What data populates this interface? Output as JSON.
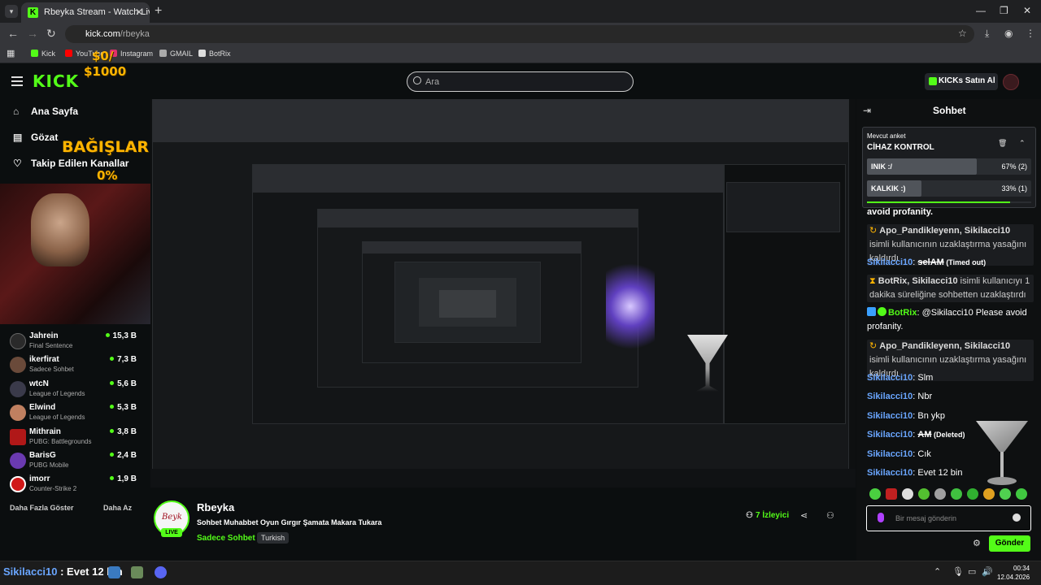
{
  "browser": {
    "tab_title": "Rbeyka Stream - Watch Live on",
    "url_host": "kick.com",
    "url_path": "/rbeyka",
    "bookmarks": [
      "Kick",
      "YouTube",
      "Instagram",
      "GMAIL",
      "BotRix"
    ]
  },
  "header": {
    "logo": "KICK",
    "search_placeholder": "Ara",
    "buy_kicks": "KICKs Satın Al"
  },
  "overlay": {
    "donation_amount": "$0/",
    "donation_goal": "$1000",
    "donations_label": "BAĞIŞLAR",
    "donations_percent": "0%"
  },
  "sidebar": {
    "nav": [
      "Ana Sayfa",
      "Gözat",
      "Takip Edilen Kanallar"
    ],
    "channels": [
      {
        "name": "Jahrein",
        "game": "Final Sentence",
        "viewers": "15,3 B",
        "color": "#2a2a2a"
      },
      {
        "name": "ikerfirat",
        "game": "Sadece Sohbet",
        "viewers": "7,3 B",
        "color": "#6a4a3a"
      },
      {
        "name": "wtcN",
        "game": "League of Legends",
        "viewers": "5,6 B",
        "color": "#3a3a4a"
      },
      {
        "name": "Elwind",
        "game": "League of Legends",
        "viewers": "5,3 B",
        "color": "#c08060"
      },
      {
        "name": "Mithrain",
        "game": "PUBG: Battlegrounds",
        "viewers": "3,8 B",
        "color": "#b01818"
      },
      {
        "name": "BarisG",
        "game": "PUBG Mobile",
        "viewers": "2,4 B",
        "color": "#6a3ab0"
      },
      {
        "name": "imorr",
        "game": "Counter-Strike 2",
        "viewers": "1,9 B",
        "color": "#d01818"
      }
    ],
    "show_more": "Daha Fazla Göster",
    "show_less": "Daha Az"
  },
  "channel": {
    "name": "Rbeyka",
    "title": "Sohbet Muhabbet Oyun Gırgır Şamata Makara Tukara",
    "category": "Sadece Sohbet",
    "tag": "Turkish",
    "viewers": "7",
    "viewers_label": "İzleyici",
    "live": "LIVE",
    "avatar_sig": "Beyk"
  },
  "chat": {
    "title": "Sohbet",
    "poll": {
      "label": "Mevcut anket",
      "title": "CİHAZ KONTROL",
      "options": [
        {
          "label": "INIK :/",
          "percent": "67% (2)",
          "fraction": 0.67
        },
        {
          "label": "KALKIK :)",
          "percent": "33% (1)",
          "fraction": 0.33
        }
      ],
      "progress": 0.87
    },
    "messages": {
      "m0": "avoid profanity.",
      "m1_user": "Apo_Pandikleyenn, Sikilacci10",
      "m1_rest": " isimli kullanıcının uzaklaştırma yasağını kaldırdı",
      "m2_user": "Sikilacci10",
      "m2_text": "selAM",
      "m2_tag": " (Timed out)",
      "m3_user": "BotRix, Sikilacci10",
      "m3_rest": " isimli kullanıcıyı 1 dakika süreliğine sohbetten uzaklaştırdı",
      "m4_user": "BotRix",
      "m4_text": " @Sikilacci10 Please avoid profanity.",
      "m5_user": "Apo_Pandikleyenn, Sikilacci10",
      "m5_rest": " isimli kullanıcının uzaklaştırma yasağını kaldırdı",
      "m6_user": "Sikilacci10",
      "m6_text": "Slm",
      "m7_user": "Sikilacci10",
      "m7_text": "Nbr",
      "m8_user": "Sikilacci10",
      "m8_text": "Bn ykp",
      "m9_user": "Sikilacci10",
      "m9_text": "AM",
      "m9_tag": " (Deleted)",
      "m10_user": "Sikilacci10",
      "m10_text": "Cık",
      "m11_user": "Sikilacci10",
      "m11_text": "Evet 12 bin"
    },
    "input_placeholder": "Bir mesaj gönderin",
    "send": "Gönder"
  },
  "taskbar": {
    "overlay_user": "Sikilacci10",
    "overlay_text": " : Evet 12 bin",
    "time": "00:34",
    "date": "12.04.2026"
  }
}
